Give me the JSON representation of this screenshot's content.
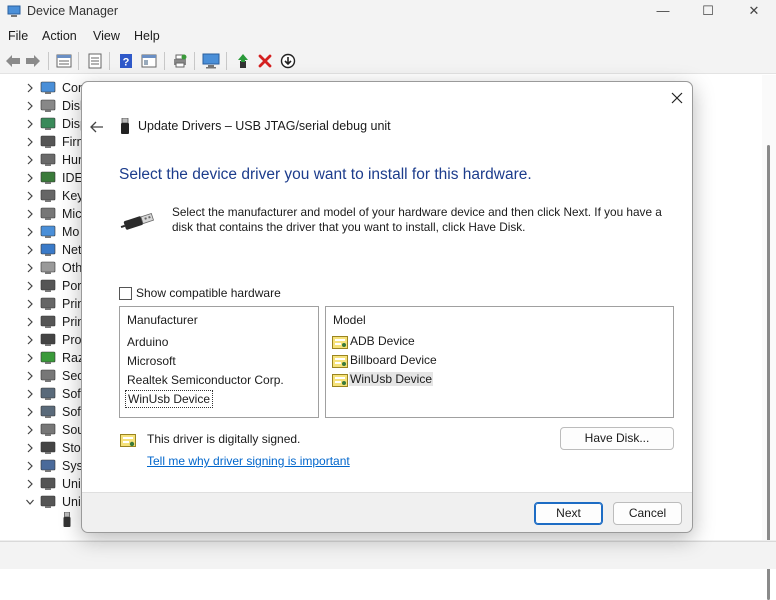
{
  "window": {
    "title": "Device Manager",
    "controls": {
      "minimize": "—",
      "maximize": "☐",
      "close": "✕"
    }
  },
  "menu": {
    "items": [
      "File",
      "Action",
      "View",
      "Help"
    ]
  },
  "toolbar": {
    "buttons": [
      "back-arrow-icon",
      "forward-arrow-icon",
      "properties-icon",
      "list-icon",
      "help-icon",
      "view-icon",
      "print-icon",
      "scan-monitor-icon",
      "update-driver-icon",
      "uninstall-icon",
      "download-icon"
    ]
  },
  "tree": {
    "items": [
      {
        "label": "Cor",
        "icon": "computer-icon",
        "expanded": false
      },
      {
        "label": "Disk",
        "icon": "disk-icon",
        "expanded": false
      },
      {
        "label": "Disp",
        "icon": "display-icon",
        "expanded": false
      },
      {
        "label": "Firm",
        "icon": "firmware-icon",
        "expanded": false
      },
      {
        "label": "Hun",
        "icon": "hid-icon",
        "expanded": false
      },
      {
        "label": "IDE",
        "icon": "ide-icon",
        "expanded": false
      },
      {
        "label": "Key",
        "icon": "keyboard-icon",
        "expanded": false
      },
      {
        "label": "Mic",
        "icon": "mouse-icon",
        "expanded": false
      },
      {
        "label": "Mo",
        "icon": "monitor-icon",
        "expanded": false
      },
      {
        "label": "Net",
        "icon": "network-icon",
        "expanded": false
      },
      {
        "label": "Oth",
        "icon": "other-device-icon",
        "expanded": false
      },
      {
        "label": "Por",
        "icon": "port-icon",
        "expanded": false
      },
      {
        "label": "Prin",
        "icon": "print-queue-icon",
        "expanded": false
      },
      {
        "label": "Prin",
        "icon": "printer-icon",
        "expanded": false
      },
      {
        "label": "Pro",
        "icon": "processor-icon",
        "expanded": false
      },
      {
        "label": "Raz",
        "icon": "razer-icon",
        "expanded": false
      },
      {
        "label": "Sec",
        "icon": "security-icon",
        "expanded": false
      },
      {
        "label": "Soft",
        "icon": "software-component-icon",
        "expanded": false
      },
      {
        "label": "Soft",
        "icon": "software-device-icon",
        "expanded": false
      },
      {
        "label": "Sou",
        "icon": "sound-icon",
        "expanded": false
      },
      {
        "label": "Stor",
        "icon": "storage-icon",
        "expanded": false
      },
      {
        "label": "Syst",
        "icon": "system-icon",
        "expanded": false
      },
      {
        "label": "Uni",
        "icon": "usb-icon",
        "expanded": false
      },
      {
        "label": "Uni",
        "icon": "usb-icon",
        "expanded": true
      }
    ]
  },
  "dialog": {
    "title": "Update Drivers – USB JTAG/serial debug unit",
    "heading": "Select the device driver you want to install for this hardware.",
    "description": "Select the manufacturer and model of your hardware device and then click Next. If you have a disk that contains the driver that you want to install, click Have Disk.",
    "show_compatible_label": "Show compatible hardware",
    "show_compatible_checked": false,
    "manufacturer": {
      "header": "Manufacturer",
      "items": [
        "Arduino",
        "Microsoft",
        "Realtek Semiconductor Corp.",
        "WinUsb Device"
      ],
      "focused_index": 3
    },
    "model": {
      "header": "Model",
      "items": [
        "ADB Device",
        "Billboard Device",
        "WinUsb Device"
      ],
      "selected_index": 2
    },
    "signed_text": "This driver is digitally signed.",
    "signing_link": "Tell me why driver signing is important",
    "have_disk_label": "Have Disk...",
    "next_label": "Next",
    "cancel_label": "Cancel"
  },
  "colors": {
    "heading": "#1c3c8c",
    "link": "#0066cc",
    "accent": "#1d6cc4",
    "uninstall_red": "#d42020",
    "help_blue": "#2f59c9"
  }
}
